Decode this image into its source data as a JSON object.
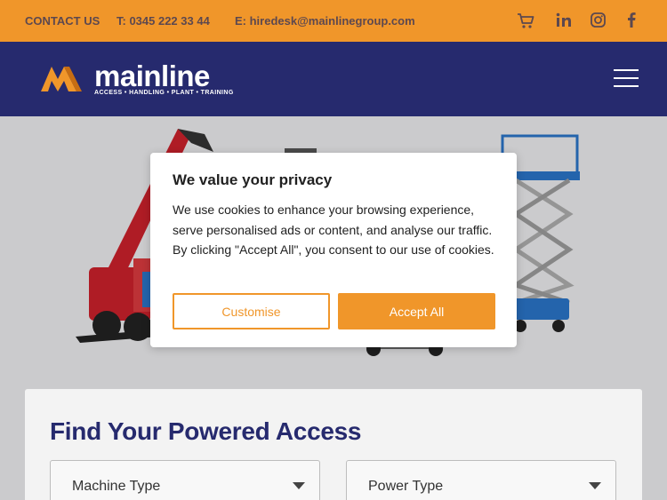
{
  "topbar": {
    "contact": "CONTACT US",
    "phone": "T: 0345 222 33 44",
    "email": "E: hiredesk@mainlinegroup.com",
    "icons": [
      "cart-icon",
      "linkedin-icon",
      "instagram-icon",
      "facebook-icon"
    ]
  },
  "header": {
    "logo_word": "mainline",
    "logo_tagline": "ACCESS • HANDLING • PLANT • TRAINING",
    "menu_icon": "hamburger-icon"
  },
  "search": {
    "title": "Find Your Powered Access",
    "machine_type": "Machine Type",
    "power_type": "Power Type"
  },
  "cookie": {
    "title": "We value your privacy",
    "body": "We use cookies to enhance your browsing experience, serve personalised ads or content, and analyse our traffic. By clicking \"Accept All\", you consent to our use of cookies.",
    "customise": "Customise",
    "accept": "Accept All"
  },
  "colors": {
    "orange": "#f0962a",
    "navy": "#262a6e",
    "hero_red": "#c8202b",
    "hero_blue": "#2a72c4"
  }
}
